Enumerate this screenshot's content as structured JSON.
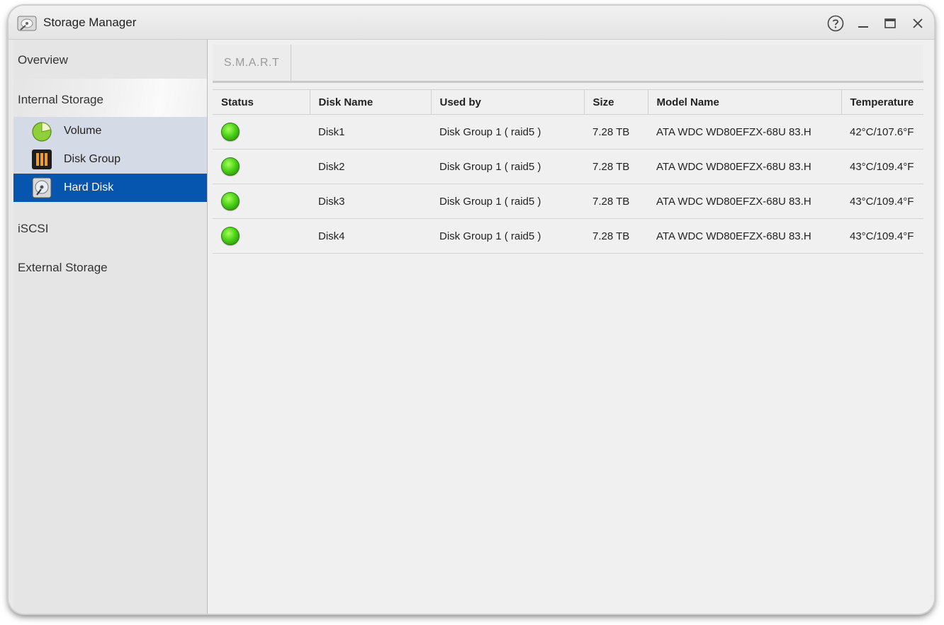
{
  "window": {
    "title": "Storage Manager",
    "controls": [
      "help-icon",
      "minimize-icon",
      "maximize-icon",
      "close-icon"
    ]
  },
  "sidebar": {
    "overview": "Overview",
    "internal_storage": "Internal Storage",
    "sub_items": [
      {
        "label": "Volume",
        "icon": "volume-pie-icon"
      },
      {
        "label": "Disk Group",
        "icon": "disk-group-icon"
      },
      {
        "label": "Hard Disk",
        "icon": "hard-disk-icon",
        "active": true
      }
    ],
    "iscsi": "iSCSI",
    "external_storage": "External Storage"
  },
  "tabs": [
    {
      "label": "S.M.A.R.T"
    }
  ],
  "table": {
    "columns": [
      "Status",
      "Disk Name",
      "Used by",
      "Size",
      "Model Name",
      "Temperature"
    ],
    "rows": [
      {
        "status": "healthy",
        "name": "Disk1",
        "used_by": "Disk Group 1 ( raid5 )",
        "size": "7.28 TB",
        "model": "ATA WDC WD80EFZX-68U 83.H",
        "temperature": "42°C/107.6°F"
      },
      {
        "status": "healthy",
        "name": "Disk2",
        "used_by": "Disk Group 1 ( raid5 )",
        "size": "7.28 TB",
        "model": "ATA WDC WD80EFZX-68U 83.H",
        "temperature": "43°C/109.4°F"
      },
      {
        "status": "healthy",
        "name": "Disk3",
        "used_by": "Disk Group 1 ( raid5 )",
        "size": "7.28 TB",
        "model": "ATA WDC WD80EFZX-68U 83.H",
        "temperature": "43°C/109.4°F"
      },
      {
        "status": "healthy",
        "name": "Disk4",
        "used_by": "Disk Group 1 ( raid5 )",
        "size": "7.28 TB",
        "model": "ATA WDC WD80EFZX-68U 83.H",
        "temperature": "43°C/109.4°F"
      }
    ]
  },
  "colors": {
    "active_item_bg": "#0656b0",
    "subnav_bg": "#d5dbe6",
    "status_healthy": "#4ed21a"
  }
}
